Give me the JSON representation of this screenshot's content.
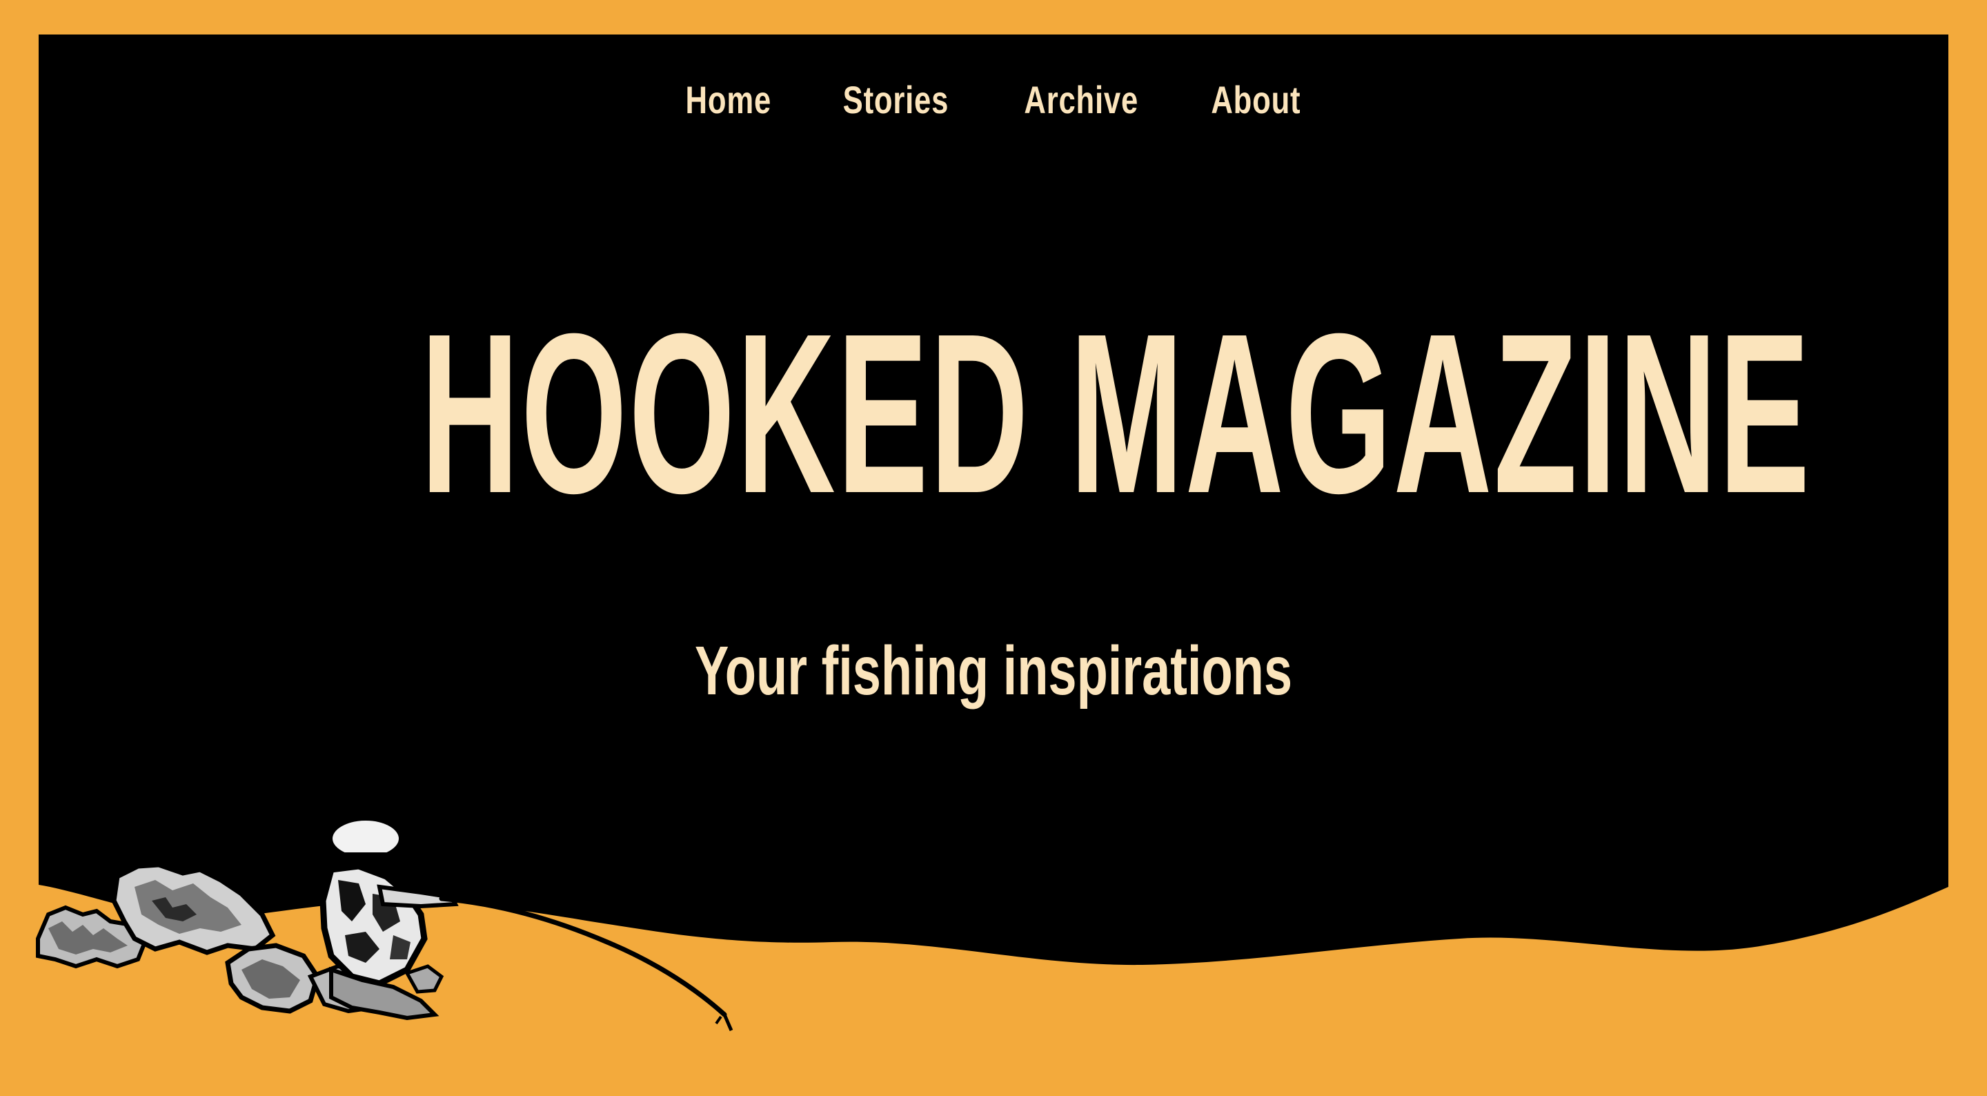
{
  "nav": {
    "items": [
      {
        "label": "Home"
      },
      {
        "label": "Stories"
      },
      {
        "label": "Archive"
      },
      {
        "label": "About"
      }
    ]
  },
  "hero": {
    "title": "HOOKED MAGAZINE",
    "subtitle": "Your fishing inspirations"
  },
  "colors": {
    "background": "#F3AA3C",
    "hero_background": "#000000",
    "text": "#FBE4BC"
  },
  "illustration": {
    "icon": "fisherman-illustration"
  }
}
